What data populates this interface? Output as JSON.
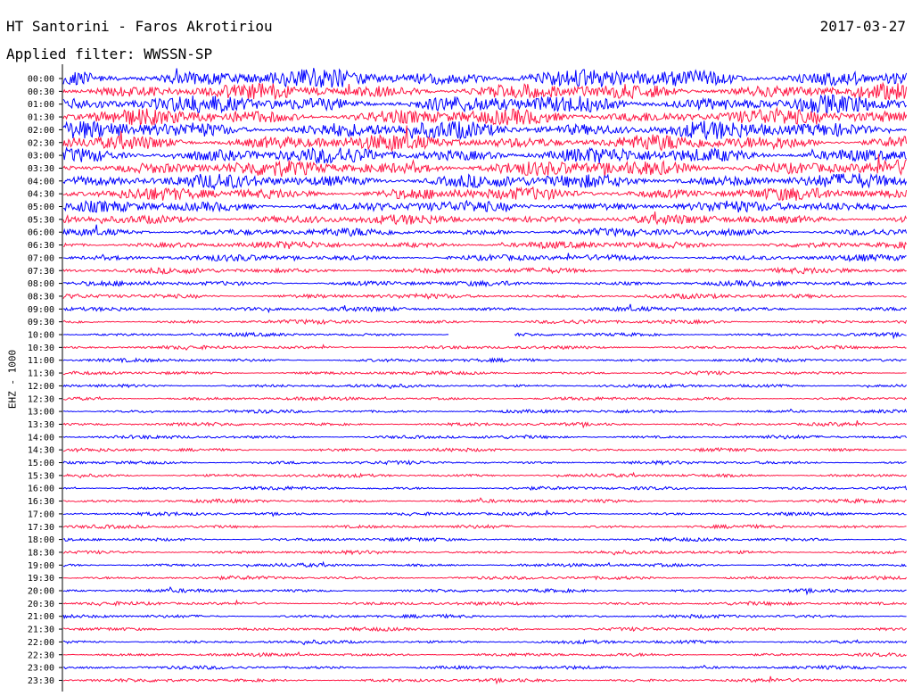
{
  "header": {
    "station": "HT Santorini - Faros Akrotiriou",
    "date": "2017-03-27",
    "filter": "Applied filter: WWSSN-SP"
  },
  "chart_data": {
    "type": "line",
    "title": "HT Santorini - Faros Akrotiriou",
    "ylabel": "EHZ - 1000",
    "row_labels": [
      "00:00",
      "00:30",
      "01:00",
      "01:30",
      "02:00",
      "02:30",
      "03:00",
      "03:30",
      "04:00",
      "04:30",
      "05:00",
      "05:30",
      "06:00",
      "06:30",
      "07:00",
      "07:30",
      "08:00",
      "08:30",
      "09:00",
      "09:30",
      "10:00",
      "10:30",
      "11:00",
      "11:30",
      "12:00",
      "12:30",
      "13:00",
      "13:30",
      "14:00",
      "14:30",
      "15:00",
      "15:30",
      "16:00",
      "16:30",
      "17:00",
      "17:30",
      "18:00",
      "18:30",
      "19:00",
      "19:30",
      "20:00",
      "20:30",
      "21:00",
      "21:30",
      "22:00",
      "22:30",
      "23:00",
      "23:30"
    ],
    "trace_colors": [
      "#0000ff",
      "#ff1744"
    ],
    "relative_amplitude": [
      12,
      10,
      11,
      10,
      11,
      10,
      10,
      10,
      9,
      8,
      7,
      6,
      5,
      4.5,
      4,
      3.5,
      3.2,
      3,
      2.8,
      2.6,
      2.2,
      2.2,
      2.2,
      2.2,
      2.2,
      2.2,
      2.2,
      2.2,
      2.2,
      2.2,
      2.2,
      2.2,
      2.2,
      2.2,
      2.2,
      2.2,
      2.2,
      2.2,
      2.2,
      2.2,
      2.2,
      2.2,
      2.2,
      2.2,
      2.2,
      2.2,
      2.2,
      2.2
    ],
    "data_gap": {
      "row": "10:00",
      "from_fraction": 0.457,
      "to_fraction": 0.535
    }
  }
}
